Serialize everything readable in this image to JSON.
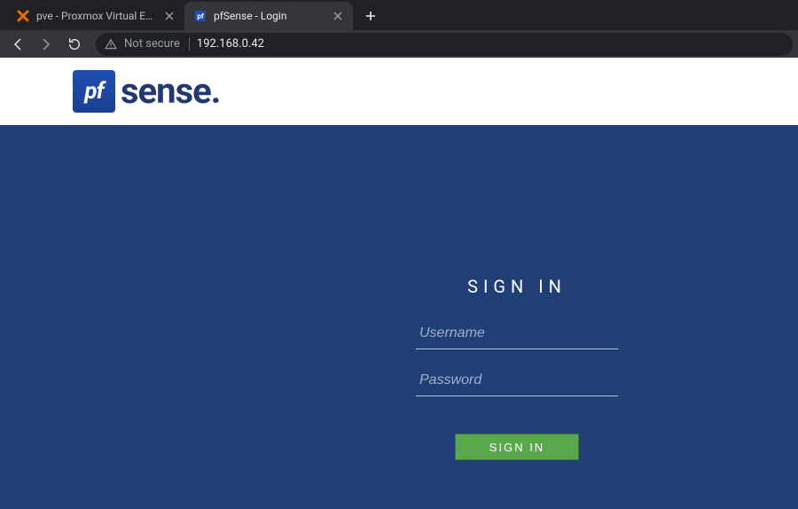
{
  "browser": {
    "tabs": [
      {
        "title": "pve - Proxmox Virtual Environme",
        "active": false
      },
      {
        "title": "pfSense - Login",
        "active": true
      }
    ],
    "not_secure_label": "Not secure",
    "url": "192.168.0.42"
  },
  "logo": {
    "mark": "pf",
    "word": "sense"
  },
  "login": {
    "title": "SIGN IN",
    "username_placeholder": "Username",
    "password_placeholder": "Password",
    "button_label": "SIGN IN"
  }
}
